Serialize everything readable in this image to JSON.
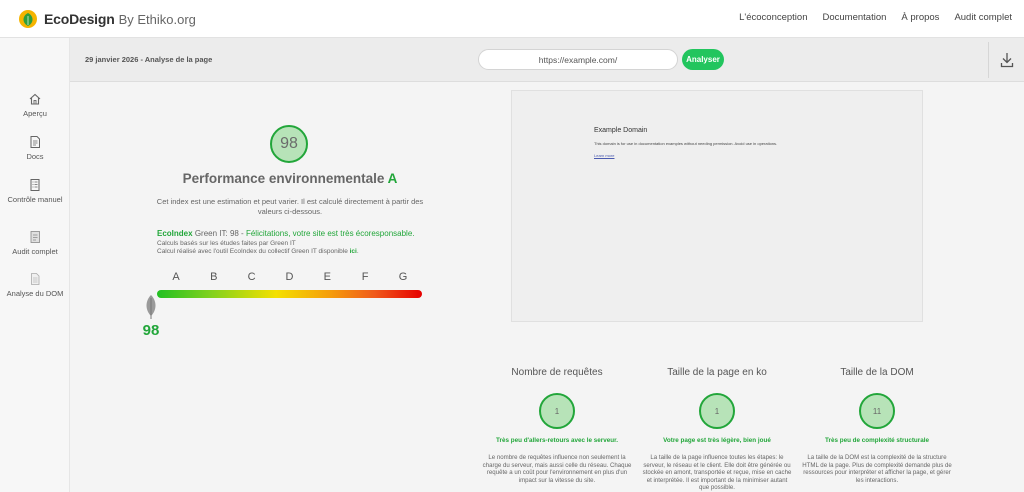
{
  "header": {
    "brand": "EcoDesign",
    "by": "By Ethiko.org",
    "nav": [
      "L'écoconception",
      "Documentation",
      "À propos",
      "Audit complet"
    ]
  },
  "sidebar": {
    "items": [
      {
        "label": "Aperçu",
        "icon": "home-icon"
      },
      {
        "label": "Docs",
        "icon": "document-icon"
      },
      {
        "label": "Contrôle manuel",
        "icon": "checklist-icon"
      },
      {
        "label": "Audit complet",
        "icon": "audit-icon"
      },
      {
        "label": "Analyse du DOM",
        "icon": "dom-file-icon"
      }
    ]
  },
  "toolbar": {
    "date_label": "29 janvier 2026 - Analyse de la page",
    "url_value": "https://example.com/",
    "analyze_label": "Analyser",
    "download_icon": "download-icon"
  },
  "score": {
    "value": "98",
    "title": "Performance environnementale",
    "grade": "A",
    "description": "Cet index est une estimation et peut varier. Il est calculé directement à partir des valeurs ci-dessous.",
    "ecoindex_label": "EcoIndex",
    "ecoindex_text": "Green IT: 98 -",
    "ecoindex_message": "Félicitations, votre site est très écoresponsable.",
    "calc_line_1": "Calculs basés sur les études faites par Green IT",
    "calc_line_2": "Calcul réalisé avec l'outil EcoIndex du collectif Green IT disponible",
    "calc_link": "ici",
    "scale_letters": [
      "A",
      "B",
      "C",
      "D",
      "E",
      "F",
      "G"
    ],
    "marker_position": 0.0,
    "marker_value": "98"
  },
  "preview": {
    "title": "Example Domain",
    "text": "This domain is for use in documentation examples without needing permission. Avoid use in operations.",
    "link": "Learn more"
  },
  "metrics": [
    {
      "title": "Nombre de requêtes",
      "value": "1",
      "verdict": "Très peu d'allers-retours avec le serveur.",
      "description": "Le nombre de requêtes influence non seulement la charge du serveur, mais aussi celle du réseau. Chaque requête a un coût pour l'environnement en plus d'un impact sur la vitesse du site."
    },
    {
      "title": "Taille de la page en ko",
      "value": "1",
      "verdict": "Votre page est très légère, bien joué",
      "description": "La taille de la page influence toutes les étapes: le serveur, le réseau et le client. Elle doit être générée ou stockée en amont, transportée et reçue, mise en cache et interprétée. Il est important de la minimiser autant que possible."
    },
    {
      "title": "Taille de la DOM",
      "value": "11",
      "verdict": "Très peu de complexité structurale",
      "description": "La taille de la DOM est la complexité de la structure HTML de la page. Plus de complexité demande plus de ressources pour interpréter et afficher la page, et gérer les interactions."
    }
  ],
  "colors": {
    "accent": "#22a63a",
    "button": "#22c55e",
    "circle_fill": "#b7e3b8"
  }
}
